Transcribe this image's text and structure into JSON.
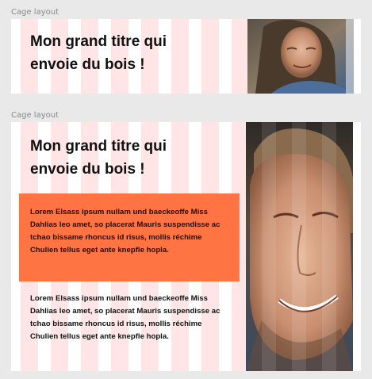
{
  "frames": [
    {
      "label": "Cage layout",
      "title": "Mon grand titre qui envoie du bois !"
    },
    {
      "label": "Cage layout",
      "title": "Mon grand titre qui envoie du bois !",
      "highlight_paragraph": "Lorem Elsass ipsum nullam und baeckeoffe Miss Dahlias leo amet, so placerat Mauris suspendisse ac tchao bissame rhoncus id risus, mollis réchime Chulien tellus eget ante knepfle hopla.",
      "paragraph": "Lorem Elsass ipsum nullam und baeckeoffe Miss Dahlias leo amet, so placerat Mauris suspendisse ac tchao bissame rhoncus id risus, mollis réchime Chulien tellus eget ante knepfle hopla."
    }
  ],
  "colors": {
    "canvas_bg": "#e9e9e9",
    "frame_bg": "#ffffff",
    "grid_column": "rgba(255,0,0,0.10)",
    "highlight_block": "#ff7442",
    "text": "#111111"
  }
}
